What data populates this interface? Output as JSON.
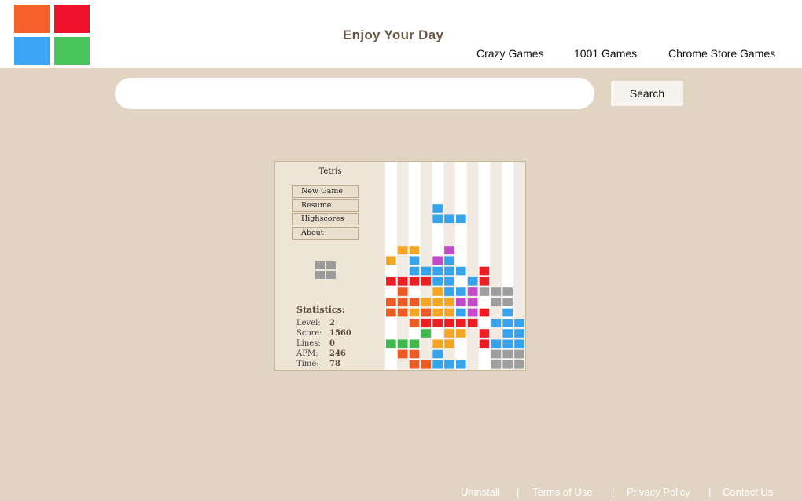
{
  "header": {
    "site_title": "Enjoy Your Day",
    "nav": [
      "Crazy Games",
      "1001 Games",
      "Chrome Store Games"
    ]
  },
  "search": {
    "placeholder": "",
    "button_label": "Search"
  },
  "game": {
    "title": "Tetris",
    "menu": [
      "New Game",
      "Resume",
      "Highscores",
      "About"
    ],
    "stats_title": "Statistics:",
    "stats": [
      {
        "label": "Level:",
        "value": "2"
      },
      {
        "label": "Score:",
        "value": "1560"
      },
      {
        "label": "Lines:",
        "value": "0"
      },
      {
        "label": "APM:",
        "value": "246"
      },
      {
        "label": "Time:",
        "value": "78"
      }
    ],
    "colors": {
      "B": "#36a3ec",
      "O": "#f4a623",
      "R": "#ee1d23",
      "G": "#3fba4d",
      "P": "#c548c8",
      "D": "#ee5a24",
      "g": "#9e9e9e"
    },
    "board": [
      "............",
      "............",
      "............",
      "............",
      "....B.......",
      "....BBB.....",
      "............",
      "............",
      ".OO..P......",
      "O.B.PB......",
      "..BBBBB.R...",
      "RRRRBB.BR...",
      ".D..OBBPggg.",
      "DDDOOOPP.gg.",
      "DDODOOBPR.B.",
      "..DRRRRR.BBB",
      "...G.OO.R.BB",
      "GGG.OO..RBBB",
      ".DD.B....ggg",
      "..DDBBB..ggg"
    ]
  },
  "footer": [
    "Uninstall",
    "Terms of Use",
    "Privacy Policy",
    "Contact Us"
  ]
}
